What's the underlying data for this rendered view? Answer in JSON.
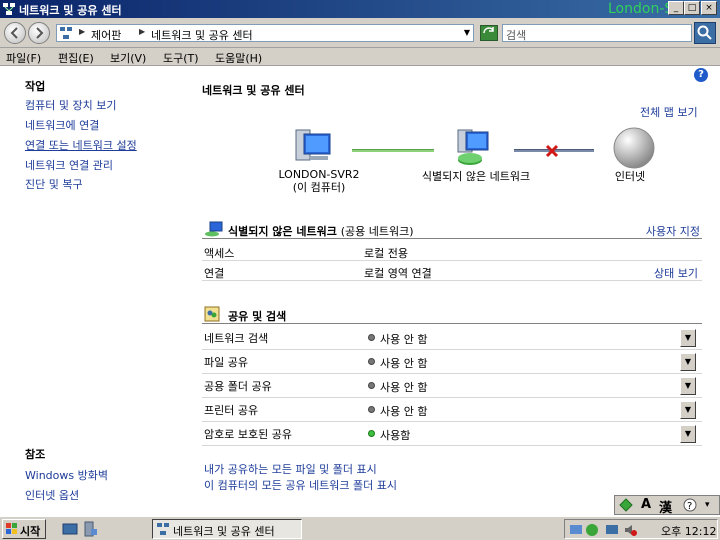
{
  "window": {
    "title": "네트워크 및 공유 센터",
    "overlay_text": "London-SVR2",
    "controls": [
      "_",
      "□",
      "×"
    ]
  },
  "address": {
    "crumbs": [
      "제어판",
      "네트워크 및 공유 센터"
    ],
    "search_placeholder": "검색"
  },
  "menu": [
    "파일(F)",
    "편집(E)",
    "보기(V)",
    "도구(T)",
    "도움말(H)"
  ],
  "left": {
    "tasks_title": "작업",
    "tasks": [
      "컴퓨터 및 장치 보기",
      "네트워크에 연결",
      "연결 또는 네트워크 설정",
      "네트워크 연결 관리",
      "진단 및 복구"
    ],
    "see_also_title": "참조",
    "see_also": [
      "Windows 방화벽",
      "인터넷 옵션"
    ]
  },
  "main": {
    "title": "네트워크 및 공유 센터",
    "full_map": "전체 맵 보기",
    "map": {
      "computer_name": "LONDON-SVR2",
      "computer_sub": "(이 컴퓨터)",
      "network": "식별되지 않은 네트워크",
      "internet": "인터넷"
    },
    "network_panel": {
      "title": "식별되지 않은 네트워크",
      "subtitle": "(공용 네트워크)",
      "customize": "사용자 지정",
      "rows": [
        {
          "key": "액세스",
          "value": "로컬 전용",
          "action": ""
        },
        {
          "key": "연결",
          "value": "로컬 영역 연결",
          "action": "상태 보기"
        }
      ]
    },
    "sharing_panel": {
      "title": "공유 및 검색",
      "rows": [
        {
          "key": "네트워크 검색",
          "state": "사용 안 함",
          "on": false
        },
        {
          "key": "파일 공유",
          "state": "사용 안 함",
          "on": false
        },
        {
          "key": "공용 폴더 공유",
          "state": "사용 안 함",
          "on": false
        },
        {
          "key": "프린터 공유",
          "state": "사용 안 함",
          "on": false
        },
        {
          "key": "암호로 보호된 공유",
          "state": "사용함",
          "on": true
        }
      ]
    },
    "bottom_links": [
      "내가 공유하는 모든 파일 및 폴더 표시",
      "이 컴퓨터의 모든 공유 네트워크 폴더 표시"
    ]
  },
  "ime": {
    "lang": "A",
    "hanja": "漢"
  },
  "taskbar": {
    "start": "시작",
    "task": "네트워크 및 공유 센터",
    "time": "오후 12:12"
  },
  "colors": {
    "link": "#1e3c9a",
    "title_start": "#0a246a",
    "title_end": "#3a6ea5"
  }
}
